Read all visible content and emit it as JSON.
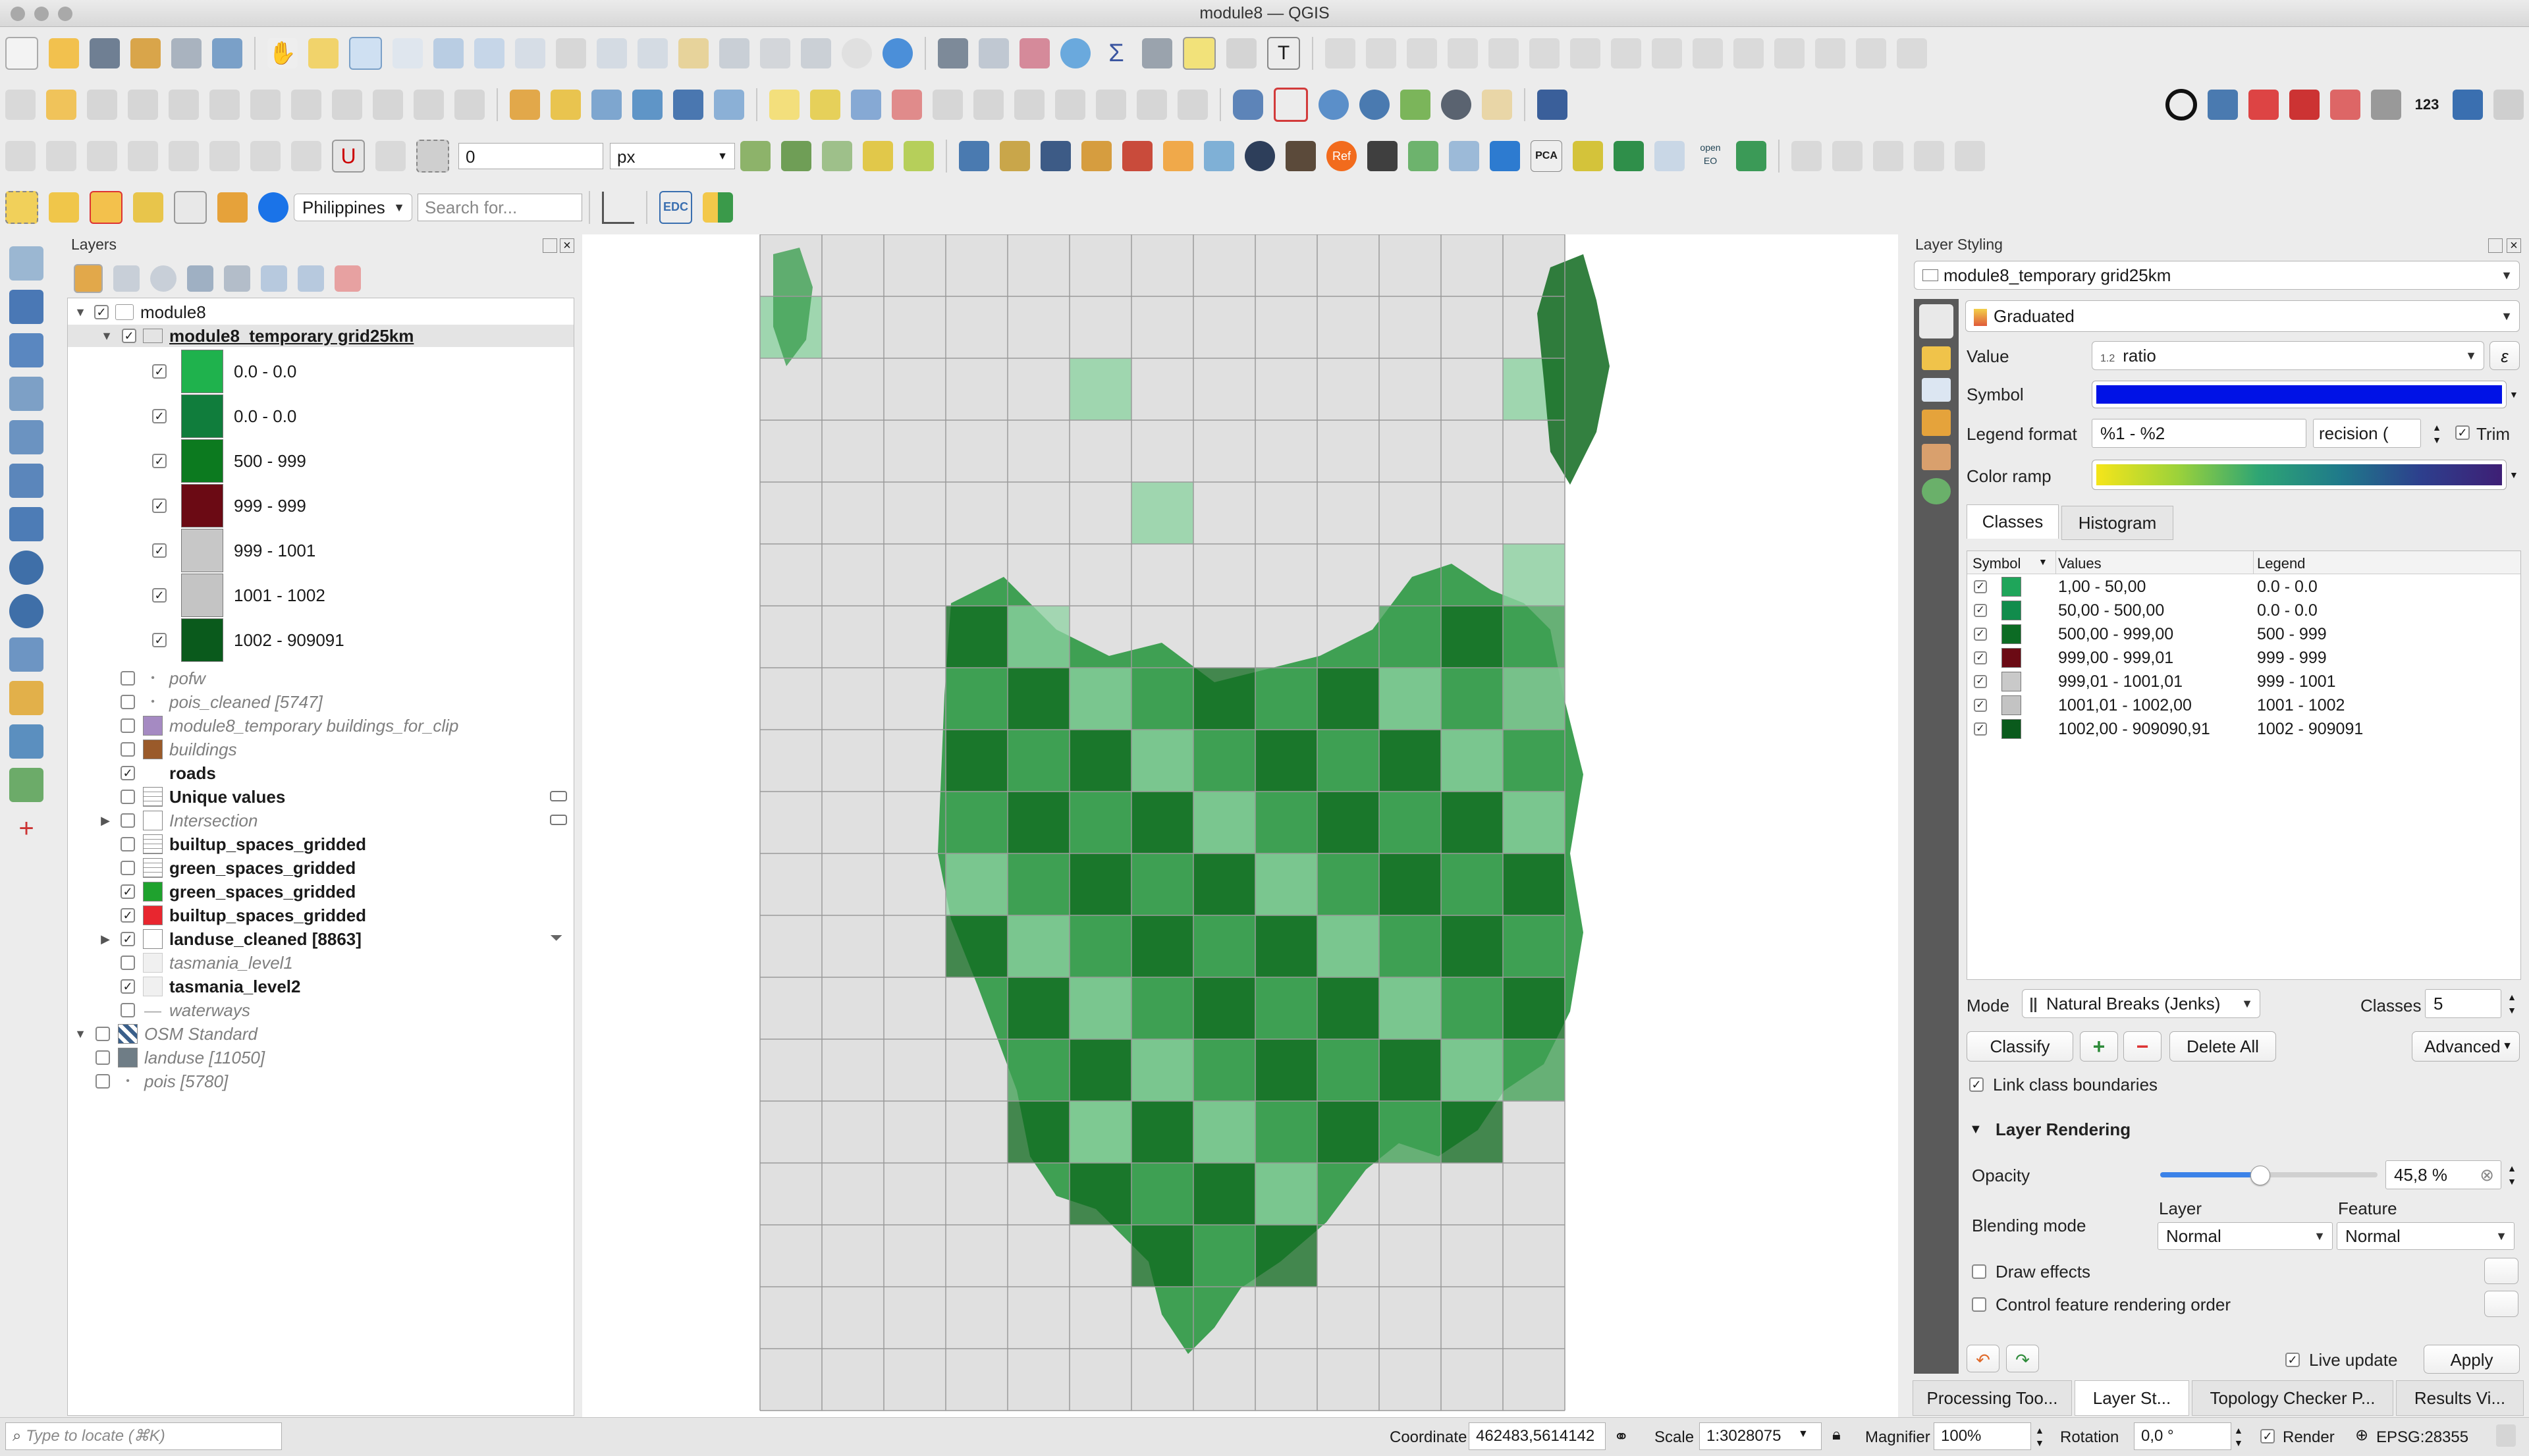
{
  "window": {
    "title": "module8 — QGIS"
  },
  "toolbar": {
    "symbol_size_value": "0",
    "symbol_unit": "px",
    "locator_country": "Philippines",
    "search_placeholder": "Search for...",
    "edc_label": "EDC",
    "pca_label": "PCA",
    "ref_label": "Ref",
    "numbers_label": "123",
    "openeo_label": "open EO"
  },
  "layers_panel": {
    "title": "Layers",
    "root_group": "module8",
    "active_layer": "module8_temporary grid25km",
    "legend_items": [
      {
        "label": "0.0 - 0.0",
        "color": "#1fb24d",
        "checked": true
      },
      {
        "label": "0.0 - 0.0",
        "color": "#107d3c",
        "checked": true
      },
      {
        "label": "500 - 999",
        "color": "#0c7a1f",
        "checked": true
      },
      {
        "label": "999 - 999",
        "color": "#6b0a14",
        "checked": true
      },
      {
        "label": "999 - 1001",
        "color": "#c7c7c7",
        "checked": true
      },
      {
        "label": "1001 - 1002",
        "color": "#c4c4c4",
        "checked": true
      },
      {
        "label": "1002 - 909091",
        "color": "#0a5a1c",
        "checked": true
      }
    ],
    "layers": [
      {
        "name": "pofw",
        "style": "italic",
        "checked": false,
        "icon": "point"
      },
      {
        "name": "pois_cleaned [5747]",
        "style": "italic",
        "checked": false,
        "icon": "point"
      },
      {
        "name": "module8_temporary buildings_for_clip",
        "style": "italic",
        "checked": false,
        "icon": "polygon-purple"
      },
      {
        "name": "buildings",
        "style": "italic",
        "checked": false,
        "icon": "polygon-brown"
      },
      {
        "name": "roads",
        "style": "bold",
        "checked": true,
        "icon": "none"
      },
      {
        "name": "Unique values",
        "style": "bold",
        "checked": false,
        "icon": "table"
      },
      {
        "name": "Intersection",
        "style": "italic",
        "checked": false,
        "icon": "polygon-outline"
      },
      {
        "name": "builtup_spaces_gridded",
        "style": "bold",
        "checked": false,
        "icon": "table"
      },
      {
        "name": "green_spaces_gridded",
        "style": "bold",
        "checked": false,
        "icon": "table"
      },
      {
        "name": "green_spaces_gridded",
        "style": "bold",
        "checked": true,
        "icon": "polygon-green"
      },
      {
        "name": "builtup_spaces_gridded",
        "style": "bold",
        "checked": true,
        "icon": "polygon-red"
      },
      {
        "name": "landuse_cleaned [8863]",
        "style": "bold",
        "checked": true,
        "icon": "polygon-outline"
      },
      {
        "name": "tasmania_level1",
        "style": "italic",
        "checked": false,
        "icon": "polygon-light"
      },
      {
        "name": "tasmania_level2",
        "style": "bold",
        "checked": true,
        "icon": "polygon-light"
      },
      {
        "name": "waterways",
        "style": "italic",
        "checked": false,
        "icon": "line"
      }
    ],
    "bottom_layers": [
      {
        "name": "OSM Standard",
        "checked": false,
        "icon": "raster"
      },
      {
        "name": "landuse [11050]",
        "checked": false,
        "icon": "polygon-slate"
      },
      {
        "name": "pois [5780]",
        "checked": false,
        "icon": "point"
      }
    ]
  },
  "styling_panel": {
    "title": "Layer Styling",
    "layer_name": "module8_temporary grid25km",
    "renderer": "Graduated",
    "value_label": "Value",
    "value_field": "ratio",
    "value_type_tag": "1.2",
    "symbol_label": "Symbol",
    "symbol_color": "#0012e6",
    "legend_format_label": "Legend format",
    "legend_format_value": "%1 - %2",
    "precision_value": "recision (",
    "trim_label": "Trim",
    "color_ramp_label": "Color ramp",
    "tabs": [
      "Classes",
      "Histogram"
    ],
    "table_headers": [
      "Symbol",
      "Values",
      "Legend"
    ],
    "classes": [
      {
        "color": "#1fa55a",
        "values": "1,00 - 50,00",
        "legend": "0.0 - 0.0"
      },
      {
        "color": "#118c4c",
        "values": "50,00 - 500,00",
        "legend": "0.0 - 0.0"
      },
      {
        "color": "#0c6b24",
        "values": "500,00 - 999,00",
        "legend": "500 - 999"
      },
      {
        "color": "#6b0a14",
        "values": "999,00 - 999,01",
        "legend": "999 - 999"
      },
      {
        "color": "#c9c9c9",
        "values": "999,01 - 1001,01",
        "legend": "999 - 1001"
      },
      {
        "color": "#c3c3c3",
        "values": "1001,01 - 1002,00",
        "legend": "1001 - 1002"
      },
      {
        "color": "#0a5a1c",
        "values": "1002,00 - 909090,91",
        "legend": "1002 - 909091"
      }
    ],
    "mode_label": "Mode",
    "mode_value": "Natural Breaks (Jenks)",
    "classes_label": "Classes",
    "classes_count": "5",
    "classify_button": "Classify",
    "delete_all_button": "Delete All",
    "advanced_button": "Advanced",
    "link_boundaries_label": "Link class boundaries",
    "layer_rendering_title": "Layer Rendering",
    "opacity_label": "Opacity",
    "opacity_value": "45,8 %",
    "opacity_fraction": 0.458,
    "blending_label": "Blending mode",
    "layer_col_label": "Layer",
    "feature_col_label": "Feature",
    "layer_blend": "Normal",
    "feature_blend": "Normal",
    "draw_effects_label": "Draw effects",
    "control_order_label": "Control feature rendering order",
    "live_update_label": "Live update",
    "apply_button": "Apply"
  },
  "bottom_tabs": [
    "Processing Too...",
    "Layer St...",
    "Topology Checker P...",
    "Results Vi..."
  ],
  "status_bar": {
    "locate_placeholder": "Type to locate (⌘K)",
    "coordinate_label": "Coordinate",
    "coordinate_value": "462483,5614142",
    "scale_label": "Scale",
    "scale_value": "1:3028075",
    "magnifier_label": "Magnifier",
    "magnifier_value": "100%",
    "rotation_label": "Rotation",
    "rotation_value": "0,0 °",
    "render_label": "Render",
    "crs_label": "EPSG:28355"
  },
  "colors": {
    "grid_light": "#8fd3a3",
    "grid_mid": "#3fa053",
    "grid_dark": "#0f6a1e",
    "grid_gray": "#e0e0e0",
    "accent_blue": "#1a73e8"
  }
}
